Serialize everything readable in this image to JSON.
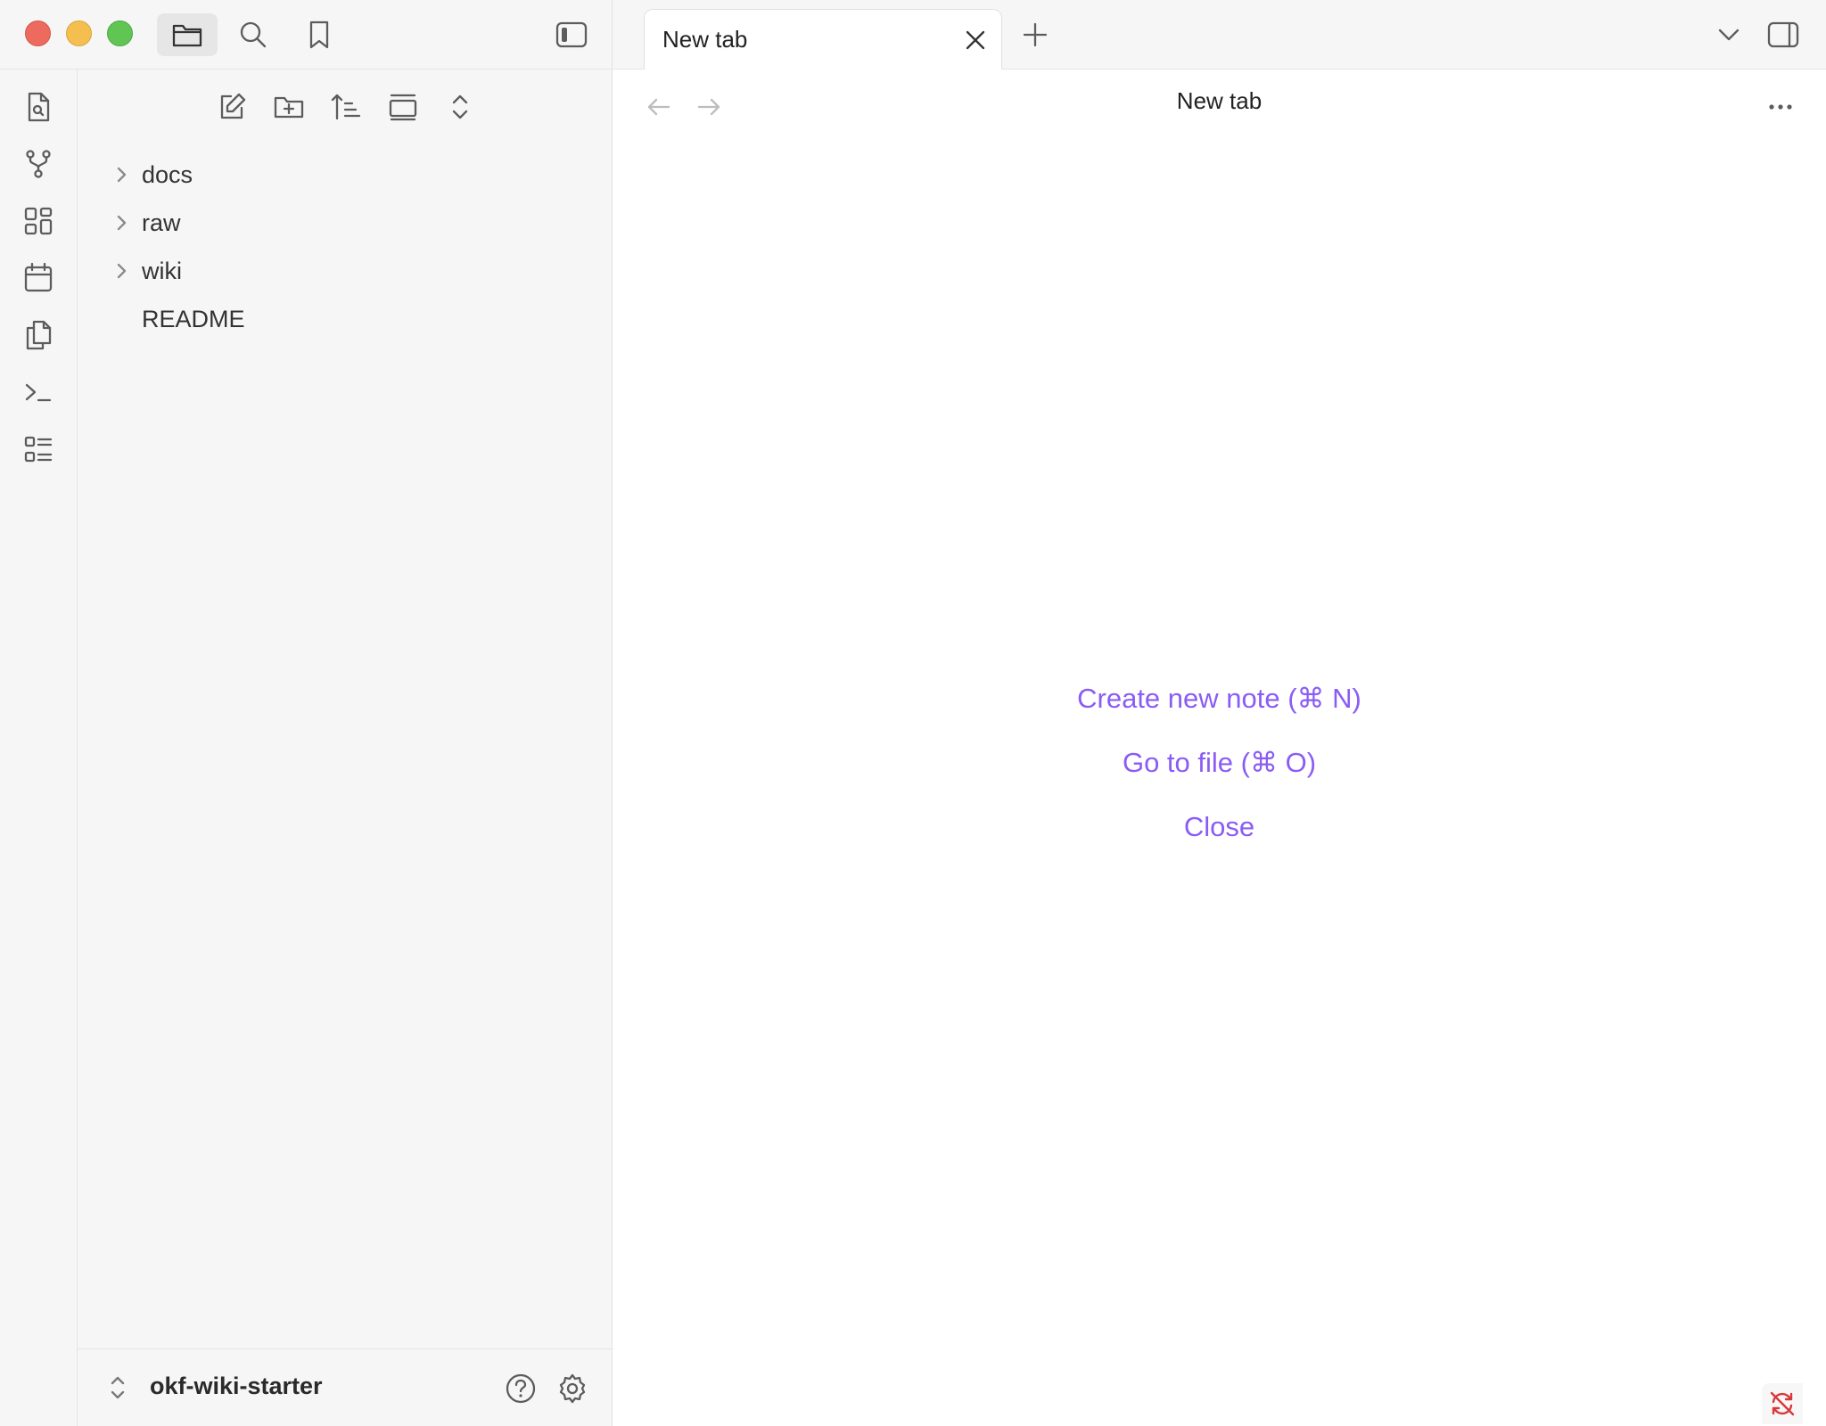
{
  "window": {
    "traffic_lights": {
      "close_color": "#ed6a5e",
      "minimize_color": "#f5bf4f",
      "maximize_color": "#61c554"
    }
  },
  "top_left_toolbar": {
    "icons": [
      "folder-icon",
      "search-icon",
      "bookmark-icon"
    ],
    "sidebar_toggle_icon": "sidebar-left-icon"
  },
  "tabs": [
    {
      "label": "New tab",
      "active": true
    }
  ],
  "ribbon": {
    "icons": [
      "file-search-icon",
      "git-branch-icon",
      "dashboard-icon",
      "calendar-icon",
      "copy-icon",
      "terminal-icon",
      "list-icon"
    ]
  },
  "file_explorer": {
    "nav_icons": [
      "new-note-icon",
      "new-folder-icon",
      "sort-icon",
      "collapse-view-icon",
      "expand-collapse-icon"
    ],
    "items": [
      {
        "label": "docs",
        "type": "folder"
      },
      {
        "label": "raw",
        "type": "folder"
      },
      {
        "label": "wiki",
        "type": "folder"
      },
      {
        "label": "README",
        "type": "file"
      }
    ]
  },
  "vault": {
    "name": "okf-wiki-starter",
    "help_icon": "help-icon",
    "settings_icon": "gear-icon"
  },
  "main": {
    "view_title": "New tab",
    "actions": {
      "create_new_note": "Create new note (⌘ N)",
      "go_to_file": "Go to file (⌘ O)",
      "close": "Close"
    },
    "accent_color": "#8a5cf5",
    "sync_status_color": "#d9383a"
  }
}
